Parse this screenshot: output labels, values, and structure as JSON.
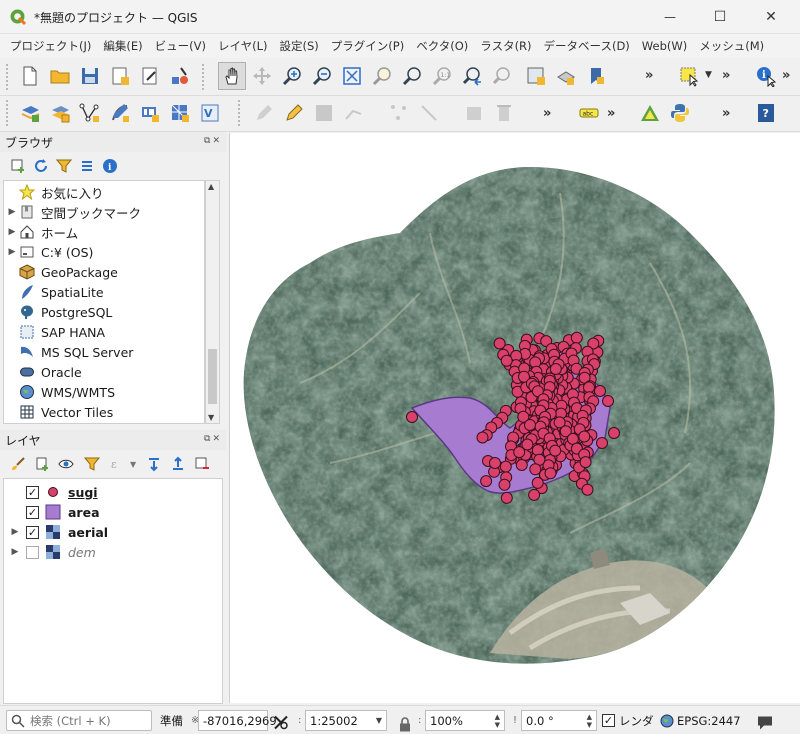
{
  "window": {
    "title": "*無題のプロジェクト — QGIS",
    "minimize": "—",
    "maximize": "☐",
    "close": "✕"
  },
  "menu": [
    "プロジェクト(J)",
    "編集(E)",
    "ビュー(V)",
    "レイヤ(L)",
    "設定(S)",
    "プラグイン(P)",
    "ベクタ(O)",
    "ラスタ(R)",
    "データベース(D)",
    "Web(W)",
    "メッシュ(M)"
  ],
  "toolbar_overflow": "»",
  "browser": {
    "title": "ブラウザ",
    "items": [
      {
        "label": "お気に入り",
        "icon": "star-icon",
        "expand": false
      },
      {
        "label": "空間ブックマーク",
        "icon": "bookmark-icon",
        "expand": true
      },
      {
        "label": "ホーム",
        "icon": "home-icon",
        "expand": true
      },
      {
        "label": "C:¥ (OS)",
        "icon": "drive-icon",
        "expand": true
      },
      {
        "label": "GeoPackage",
        "icon": "geopackage-icon",
        "expand": false
      },
      {
        "label": "SpatiaLite",
        "icon": "spatialite-icon",
        "expand": false
      },
      {
        "label": "PostgreSQL",
        "icon": "postgresql-icon",
        "expand": false
      },
      {
        "label": "SAP HANA",
        "icon": "sap-hana-icon",
        "expand": false
      },
      {
        "label": "MS SQL Server",
        "icon": "mssql-icon",
        "expand": false
      },
      {
        "label": "Oracle",
        "icon": "oracle-icon",
        "expand": false
      },
      {
        "label": "WMS/WMTS",
        "icon": "globe-icon",
        "expand": false
      },
      {
        "label": "Vector Tiles",
        "icon": "vector-tiles-icon",
        "expand": false
      }
    ]
  },
  "layers": {
    "title": "レイヤ",
    "items": [
      {
        "name": "sugi",
        "checked": true,
        "expand": false
      },
      {
        "name": "area",
        "checked": true,
        "expand": false
      },
      {
        "name": "aerial",
        "checked": true,
        "expand": true
      },
      {
        "name": "dem",
        "checked": false,
        "expand": true
      }
    ]
  },
  "status": {
    "search_placeholder": "検索 (Ctrl + K)",
    "ready": "準備",
    "coordinate": "-87016,2969",
    "scale": "1:25002",
    "magnifier": "100%",
    "rotation": "0.0 °",
    "render_label": "レンダ",
    "crs": "EPSG:2447"
  },
  "colors": {
    "point": "#d9406a",
    "point_stroke": "#3a1020",
    "area_fill": "#a67bd0",
    "area_stroke": "#5b3a85",
    "accent_green": "#589632"
  }
}
